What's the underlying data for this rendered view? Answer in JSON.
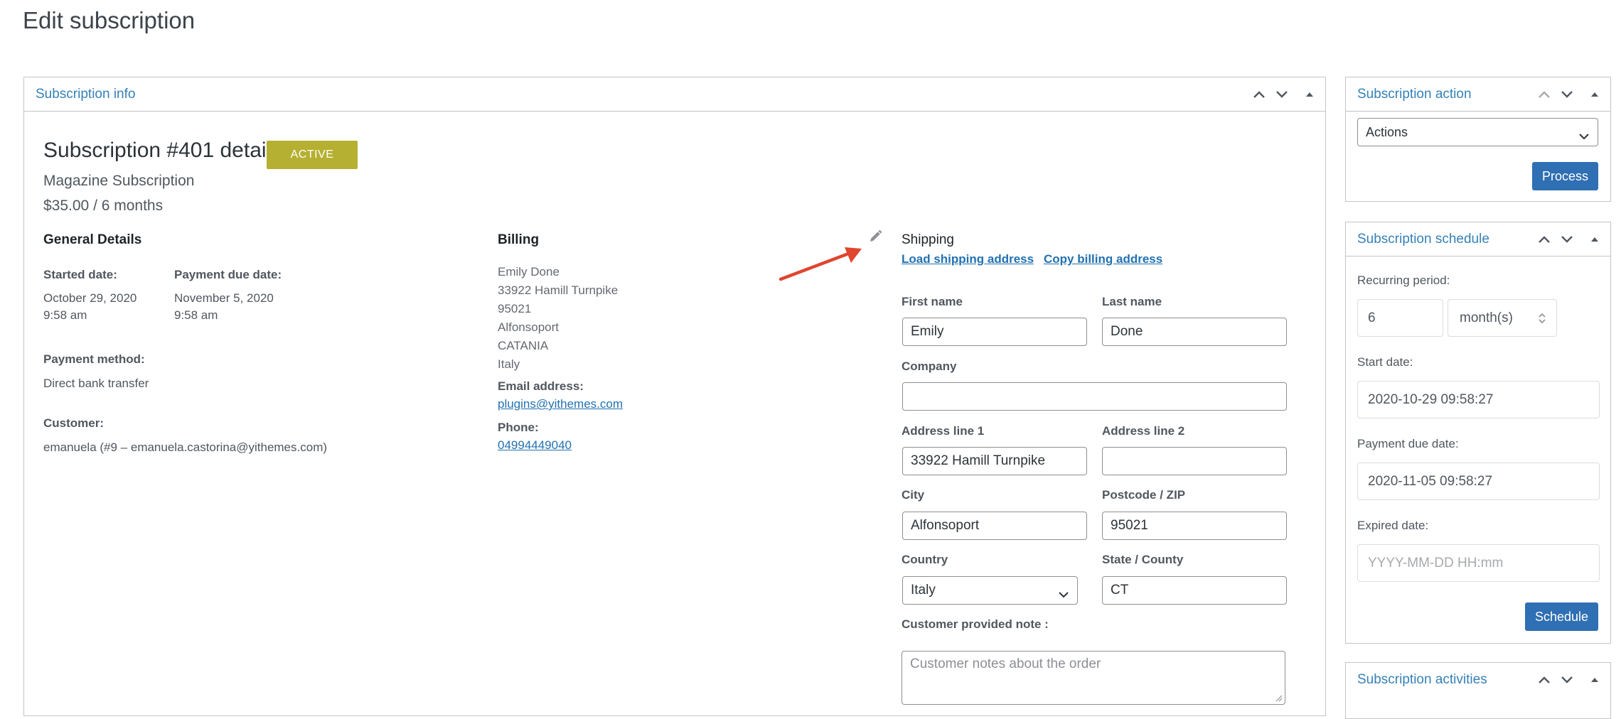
{
  "page": {
    "title": "Edit subscription"
  },
  "main_box": {
    "title": "Subscription info",
    "heading": "Subscription #401 details",
    "status": "ACTIVE",
    "product": "Magazine Subscription",
    "price": "$35.00 / 6 months"
  },
  "general": {
    "title": "General Details",
    "started_label": "Started date:",
    "started_date": "October 29, 2020",
    "started_time": "9:58 am",
    "due_label": "Payment due date:",
    "due_date": "November 5, 2020",
    "due_time": "9:58 am",
    "payment_label": "Payment method:",
    "payment_value": "Direct bank transfer",
    "customer_label": "Customer:",
    "customer_value": "emanuela (#9 – emanuela.castorina@yithemes.com)"
  },
  "billing": {
    "title": "Billing",
    "address": [
      "Emily Done",
      "33922 Hamill Turnpike",
      "95021",
      "Alfonsoport",
      "CATANIA",
      "Italy"
    ],
    "email_label": "Email address:",
    "email": "plugins@yithemes.com",
    "phone_label": "Phone:",
    "phone": "04994449040"
  },
  "shipping": {
    "title": "Shipping",
    "load_link": "Load shipping address",
    "copy_link": "Copy billing address",
    "first_name_label": "First name",
    "first_name": "Emily",
    "last_name_label": "Last name",
    "last_name": "Done",
    "company_label": "Company",
    "company": "",
    "address1_label": "Address line 1",
    "address1": "33922 Hamill Turnpike",
    "address2_label": "Address line 2",
    "address2": "",
    "city_label": "City",
    "city": "Alfonsoport",
    "postcode_label": "Postcode / ZIP",
    "postcode": "95021",
    "country_label": "Country",
    "country": "Italy",
    "state_label": "State / County",
    "state": "CT",
    "note_label": "Customer provided note :",
    "note_placeholder": "Customer notes about the order"
  },
  "sidebar": {
    "action": {
      "title": "Subscription action",
      "select_value": "Actions",
      "button": "Process"
    },
    "schedule": {
      "title": "Subscription schedule",
      "period_label": "Recurring period:",
      "period_value": "6",
      "period_unit": "month(s)",
      "start_label": "Start date:",
      "start_value": "2020-10-29 09:58:27",
      "due_label": "Payment due date:",
      "due_value": "2020-11-05 09:58:27",
      "expired_label": "Expired date:",
      "expired_placeholder": "YYYY-MM-DD HH:mm",
      "button": "Schedule"
    },
    "activities": {
      "title": "Subscription activities"
    }
  },
  "colors": {
    "accent": "#2271b1",
    "badge": "#b5b032",
    "button": "#2f6fb3",
    "arrow": "#e0452e"
  },
  "icons": [
    "chevron-up-icon",
    "chevron-down-icon",
    "triangle-up-icon",
    "pencil-icon",
    "arrow-annotation-icon"
  ]
}
